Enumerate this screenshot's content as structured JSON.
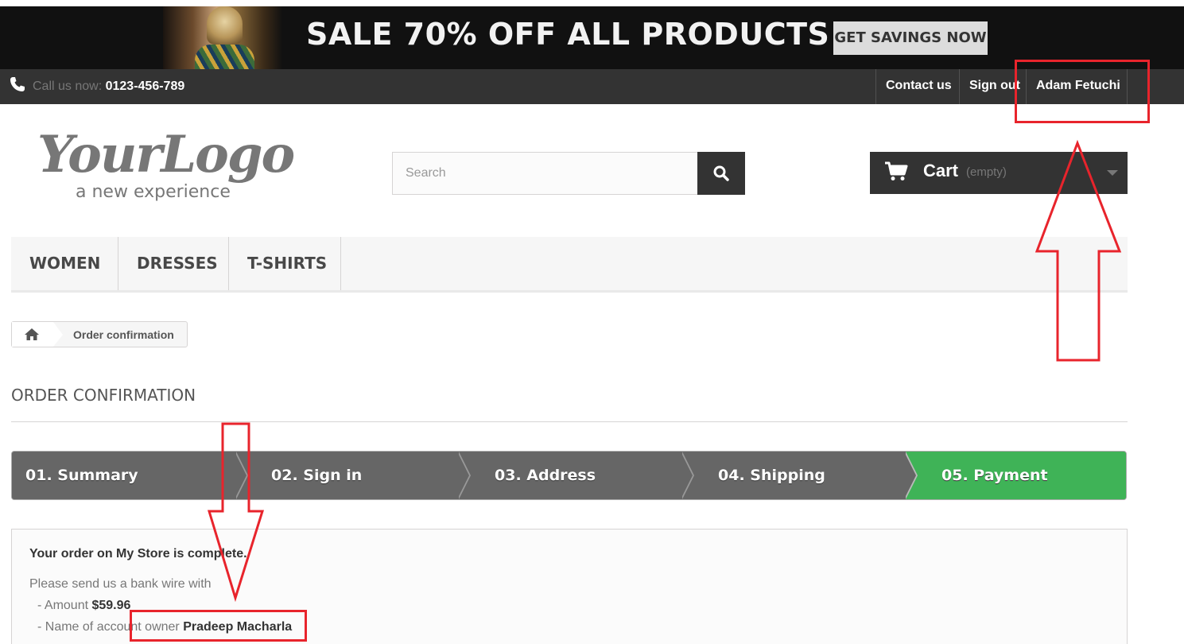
{
  "banner": {
    "text": "SALE 70% OFF ALL PRODUCTS",
    "button": "GET SAVINGS NOW"
  },
  "topbar": {
    "callus_label": "Call us now:",
    "phone": "0123-456-789",
    "links": {
      "contact": "Contact us",
      "signout": "Sign out",
      "account": "Adam Fetuchi"
    }
  },
  "logo": {
    "main": "YourLogo",
    "sub": "a new experience"
  },
  "search": {
    "placeholder": "Search"
  },
  "cart": {
    "label": "Cart",
    "status": "(empty)"
  },
  "menu": {
    "items": [
      "WOMEN",
      "DRESSES",
      "T-SHIRTS"
    ]
  },
  "breadcrumb": {
    "current": "Order confirmation"
  },
  "page": {
    "title": "ORDER CONFIRMATION"
  },
  "steps": [
    {
      "label": "01. Summary"
    },
    {
      "label": "02. Sign in"
    },
    {
      "label": "03. Address"
    },
    {
      "label": "04. Shipping"
    },
    {
      "label": "05. Payment"
    }
  ],
  "confirmation": {
    "heading": "Your order on My Store is complete.",
    "line1": "Please send us a bank wire with",
    "amount_label": "- Amount ",
    "amount_value": "$59.96",
    "owner_label": "- Name of account owner ",
    "owner_value": "Pradeep Macharla"
  },
  "colors": {
    "dark": "#333333",
    "step_gray": "#666666",
    "step_active": "#3fb357",
    "annotation": "#e8242c"
  }
}
